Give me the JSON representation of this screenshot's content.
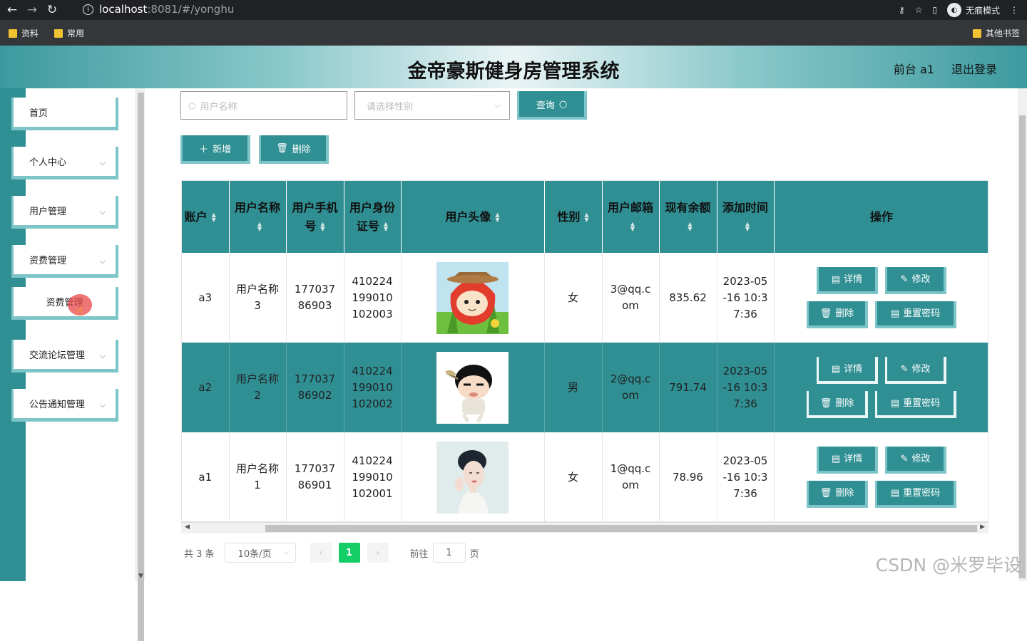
{
  "browser": {
    "url_host": "localhost",
    "url_path": ":8081/#/yonghu",
    "incognito_label": "无痕模式",
    "bookmarks": [
      "资料",
      "常用"
    ],
    "other_bookmarks": "其他书签"
  },
  "header": {
    "title": "金帝豪斯健身房管理系统",
    "front_link": "前台 a1",
    "logout": "退出登录"
  },
  "sidebar": {
    "items": [
      {
        "label": "首页"
      },
      {
        "label": "个人中心"
      },
      {
        "label": "用户管理"
      },
      {
        "label": "资费管理"
      },
      {
        "label": "资费管理"
      },
      {
        "label": "交流论坛管理"
      },
      {
        "label": "公告通知管理"
      }
    ]
  },
  "search": {
    "name_placeholder": "用户名称",
    "gender_placeholder": "请选择性别",
    "query_label": "查询"
  },
  "toolbar": {
    "add_label": "新增",
    "delete_label": "删除"
  },
  "table": {
    "headers": [
      "账户",
      "用户名称",
      "用户手机号",
      "用户身份证号",
      "用户头像",
      "性别",
      "用户邮箱",
      "现有余额",
      "添加时间",
      "操作"
    ],
    "rows": [
      {
        "account": "a3",
        "name": "用户名称3",
        "phone": "17703786903",
        "idcard": "410224199010102003",
        "gender": "女",
        "email": "3@qq.com",
        "balance": "835.62",
        "time": "2023-05-16 10:37:36"
      },
      {
        "account": "a2",
        "name": "用户名称2",
        "phone": "17703786902",
        "idcard": "410224199010102002",
        "gender": "男",
        "email": "2@qq.com",
        "balance": "791.74",
        "time": "2023-05-16 10:37:36"
      },
      {
        "account": "a1",
        "name": "用户名称1",
        "phone": "17703786901",
        "idcard": "410224199010102001",
        "gender": "女",
        "email": "1@qq.com",
        "balance": "78.96",
        "time": "2023-05-16 10:37:36"
      }
    ],
    "ops": {
      "detail": "详情",
      "edit": "修改",
      "delete": "删除",
      "reset": "重置密码"
    }
  },
  "pager": {
    "total": "共 3 条",
    "size": "10条/页",
    "current": "1",
    "goto_prefix": "前往",
    "goto_value": "1",
    "goto_suffix": "页"
  },
  "watermark": "CSDN @米罗毕设",
  "colors": {
    "teal": "#2f8f93",
    "teal_light": "#7ec5c9",
    "pager_active": "#13ce66"
  }
}
